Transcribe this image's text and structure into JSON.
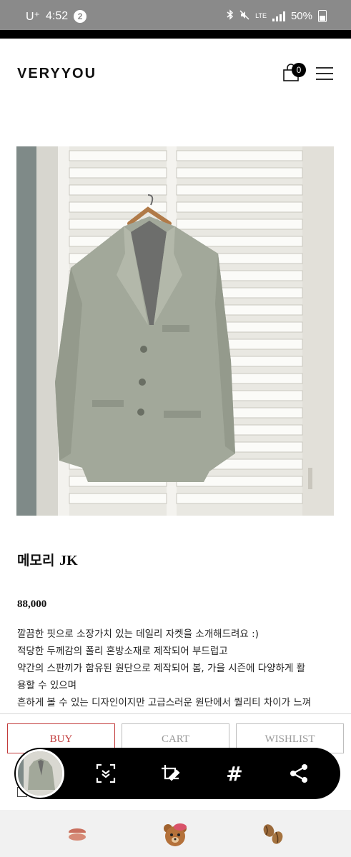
{
  "status_bar": {
    "carrier": "U⁺",
    "time": "4:52",
    "notification_count": "2",
    "network": "LTE",
    "battery": "50%"
  },
  "header": {
    "logo": "VERYYOU",
    "cart_count": "0"
  },
  "product": {
    "name_korean": "메모리",
    "name_latin": "JK",
    "price": "88,000",
    "description": [
      "깔끔한 핏으로 소장가치 있는 데일리 자켓을 소개해드려요 :)",
      "적당한 두께감의 폴리 혼방소재로 제작되어 부드럽고",
      "약간의 스판끼가 함유된 원단으로 제작되어 봄, 가을 시즌에 다양하게 활",
      "용할 수 있으며",
      "흔하게 볼 수 있는 디자인이지만 고급스러운 원단에서 퀄리티 차이가 느껴"
    ]
  },
  "actions": {
    "buy": "BUY",
    "cart": "CART",
    "wishlist": "WISHLIST"
  },
  "floating_toolbar": {
    "icons": [
      "capture-thumbnail",
      "scroll-capture-icon",
      "crop-edit-icon",
      "hashtag-icon",
      "share-icon"
    ],
    "hash_glyph": "#"
  },
  "bottom_nav": {
    "icons": [
      "macaron-icon",
      "bear-icon",
      "coffee-bean-icon"
    ]
  },
  "colors": {
    "accent_red": "#c23a3a",
    "status_bar": "#8a8a8a"
  }
}
